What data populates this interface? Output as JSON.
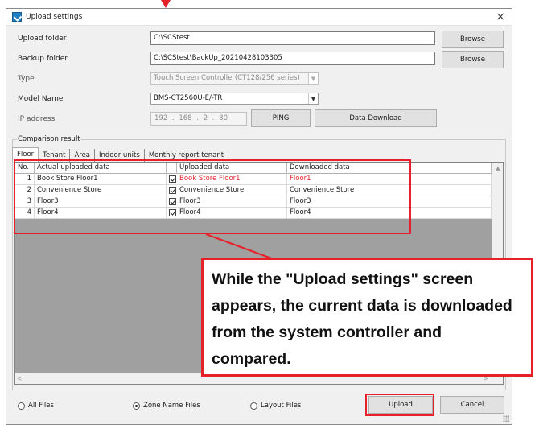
{
  "window": {
    "title": "Upload settings",
    "close_glyph": "×"
  },
  "form": {
    "upload_folder_label": "Upload folder",
    "upload_folder_value": "C:\\SCStest",
    "backup_folder_label": "Backup folder",
    "backup_folder_value": "C:\\SCStest\\BackUp_20210428103305",
    "browse_label": "Browse",
    "type_label": "Type",
    "type_value": "Touch Screen Controller(CT128/256 series)",
    "model_label": "Model Name",
    "model_value": "BMS-CT2560U-E/-TR",
    "ip_label": "IP address",
    "ip_value": "192 . 168 . 2 . 80",
    "ping_label": "PING",
    "download_label": "Data Download"
  },
  "comparison": {
    "group_title": "Comparison result",
    "tabs": [
      "Floor",
      "Tenant",
      "Area",
      "Indoor units",
      "Monthly report tenant"
    ],
    "active_tab": "Floor",
    "columns": [
      "No.",
      "Actual uploaded data",
      "Uploaded data",
      "Downloaded data"
    ],
    "rows": [
      {
        "no": "1",
        "actual": "Book Store Floor1",
        "checked": true,
        "uploaded": "Book Store Floor1",
        "downloaded": "Floor1",
        "mismatch": true
      },
      {
        "no": "2",
        "actual": "Convenience Store",
        "checked": true,
        "uploaded": "Convenience Store",
        "downloaded": "Convenience Store",
        "mismatch": false
      },
      {
        "no": "3",
        "actual": "Floor3",
        "checked": true,
        "uploaded": "Floor3",
        "downloaded": "Floor3",
        "mismatch": false
      },
      {
        "no": "4",
        "actual": "Floor4",
        "checked": true,
        "uploaded": "Floor4",
        "downloaded": "Floor4",
        "mismatch": false
      }
    ]
  },
  "file_options": {
    "all_files": "All Files",
    "zone_name_files": "Zone Name Files",
    "layout_files": "Layout Files",
    "selected": "Zone Name Files"
  },
  "actions": {
    "upload": "Upload",
    "cancel": "Cancel"
  },
  "callout": {
    "text": "While the \"Upload settings\" screen appears, the current data is downloaded from the system controller and compared."
  },
  "colors": {
    "highlight": "#e8202a",
    "mismatch_text": "#e8202a",
    "grid_background": "#a0a0a0"
  }
}
